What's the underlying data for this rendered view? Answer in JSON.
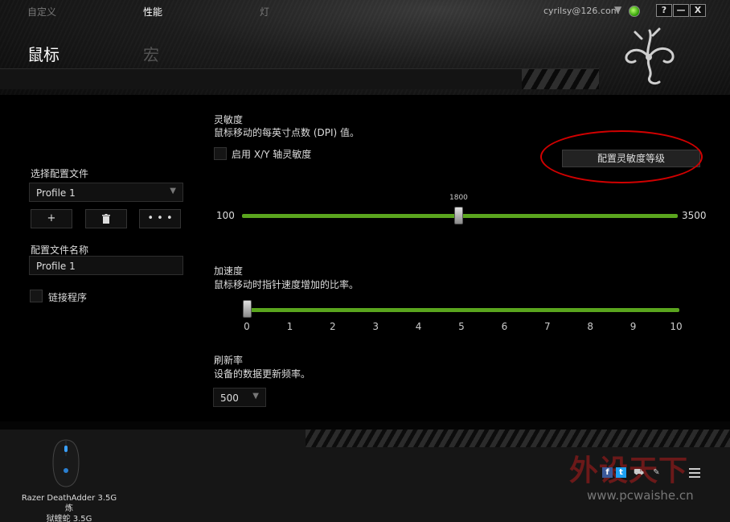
{
  "header": {
    "user_email": "cyrilsy@126.com",
    "window_buttons": [
      "?",
      "—",
      "X"
    ],
    "tabs": [
      {
        "label": "鼠标",
        "active": true
      },
      {
        "label": "宏",
        "active": false
      }
    ],
    "subtabs": [
      {
        "label": "自定义",
        "active": false
      },
      {
        "label": "性能",
        "active": true
      },
      {
        "label": "灯",
        "active": false
      }
    ]
  },
  "left": {
    "select_profile_label": "选择配置文件",
    "profile_selected": "Profile 1",
    "buttons": [
      "+",
      "🗑",
      "• • •"
    ],
    "profile_name_label": "配置文件名称",
    "profile_name_value": "Profile 1",
    "link_program_label": "链接程序"
  },
  "sensitivity": {
    "title": "灵敏度",
    "desc": "鼠标移动的每英寸点数 (DPI) 值。",
    "xy_label": "启用 X/Y 轴灵敏度",
    "config_button": "配置灵敏度等级",
    "min": "100",
    "max": "3500",
    "value": "1800"
  },
  "acceleration": {
    "title": "加速度",
    "desc": "鼠标移动时指针速度增加的比率。",
    "ticks": [
      "0",
      "1",
      "2",
      "3",
      "4",
      "5",
      "6",
      "7",
      "8",
      "9",
      "10"
    ],
    "value": 0
  },
  "polling": {
    "title": "刷新率",
    "desc": "设备的数据更新频率。",
    "value": "500"
  },
  "footer": {
    "device_name_line1": "Razer DeathAdder 3.5G 炼",
    "device_name_line2": "狱蝰蛇 3.5G",
    "watermark": "外设天下",
    "watermark_url": "www.pcwaishe.cn"
  },
  "colors": {
    "accent_green": "#5aa51e",
    "highlight_red": "#d10000"
  }
}
